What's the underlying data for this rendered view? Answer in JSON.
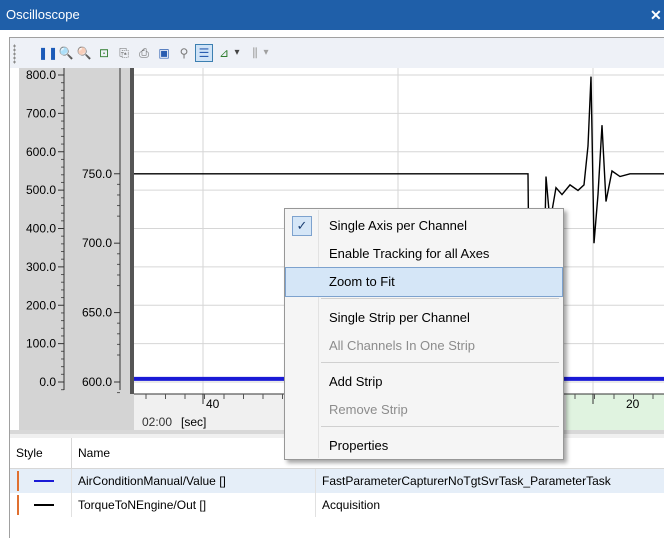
{
  "window": {
    "title": "Oscilloscope",
    "close_glyph": "✕"
  },
  "toolbar": {
    "buttons": [
      {
        "name": "pause-button",
        "icon": "pause-icon",
        "glyph": "❚❚",
        "color": "#1c5bb8"
      },
      {
        "name": "zoom-in-button",
        "icon": "zoom-in-icon",
        "glyph": "🔍",
        "color": "#2f7d2f"
      },
      {
        "name": "zoom-out-button",
        "icon": "zoom-out-icon",
        "glyph": "🔍",
        "color": "#2f7d2f"
      },
      {
        "name": "zoom-fit-button",
        "icon": "zoom-fit-icon",
        "glyph": "⊡",
        "color": "#2f7d2f"
      },
      {
        "name": "copy-button",
        "icon": "copy-icon",
        "glyph": "⎘",
        "color": "#6b6b6b"
      },
      {
        "name": "print-button",
        "icon": "printer-icon",
        "glyph": "⎙",
        "color": "#5d5d5d"
      },
      {
        "name": "save-button",
        "icon": "save-icon",
        "glyph": "▣",
        "color": "#2a5db0"
      },
      {
        "name": "cursor-button",
        "icon": "cursor-icon",
        "glyph": "⚲",
        "color": "#7a7a7a"
      },
      {
        "name": "legend-button",
        "icon": "legend-icon",
        "glyph": "☰",
        "color": "#2a5db0",
        "selected": true
      },
      {
        "name": "axis-options-button",
        "icon": "chart-axis-icon",
        "glyph": "⊿",
        "color": "#2f7d2f"
      },
      {
        "name": "axis-options-dropdown",
        "icon": "chevron-down-icon",
        "glyph": "▾",
        "color": "#444444"
      },
      {
        "name": "measure-button",
        "icon": "measure-icon",
        "glyph": "⫼",
        "color": "#a0a0a0"
      },
      {
        "name": "measure-dropdown",
        "icon": "chevron-down-icon",
        "glyph": "▾",
        "color": "#a0a0a0"
      }
    ]
  },
  "chart_data": {
    "type": "line",
    "xlabel": "[sec]",
    "x_time_label": "02:00",
    "x_tick_labels": [
      "40",
      "20"
    ],
    "y_axis_1": {
      "ticks": [
        "800.0",
        "700.0",
        "600.0",
        "500.0",
        "400.0",
        "300.0",
        "200.0",
        "100.0",
        "0.0"
      ],
      "range": [
        0,
        800
      ]
    },
    "y_axis_2": {
      "ticks": [
        "750.0",
        "700.0",
        "650.0",
        "600.0"
      ],
      "range": [
        600,
        770
      ]
    },
    "series": [
      {
        "name": "AirConditionManual/Value []",
        "color": "#1a1ad6",
        "values": [
          8,
          8
        ]
      },
      {
        "name": "TorqueToNEngine/Out []",
        "color": "#000000",
        "values": [
          750,
          750,
          660,
          762,
          818,
          750
        ]
      }
    ],
    "grid": true
  },
  "context_menu": {
    "items": [
      {
        "label": "Single Axis per Channel",
        "checked": true,
        "disabled": false,
        "highlighted": false
      },
      {
        "label": "Enable Tracking for all Axes",
        "checked": false,
        "disabled": false,
        "highlighted": false
      },
      {
        "label": "Zoom to Fit",
        "checked": false,
        "disabled": false,
        "highlighted": true
      },
      {
        "label": "Single Strip per Channel",
        "checked": false,
        "disabled": false,
        "highlighted": false
      },
      {
        "label": "All Channels In One Strip",
        "checked": false,
        "disabled": true,
        "highlighted": false
      },
      {
        "label": "Add Strip",
        "checked": false,
        "disabled": false,
        "highlighted": false
      },
      {
        "label": "Remove Strip",
        "checked": false,
        "disabled": true,
        "highlighted": false
      },
      {
        "label": "Properties",
        "checked": false,
        "disabled": false,
        "highlighted": false
      }
    ]
  },
  "channels": {
    "headers": {
      "style": "Style",
      "name": "Name"
    },
    "rows": [
      {
        "name": "AirConditionManual/Value []",
        "source": "FastParameterCapturerNoTgtSvrTask_ParameterTask",
        "line_color": "#1a1ad6",
        "marker_color": "#e07030"
      },
      {
        "name": "TorqueToNEngine/Out []",
        "source": "Acquisition",
        "line_color": "#000000",
        "marker_color": "#e07030"
      }
    ]
  },
  "colors": {
    "titlebar": "#1f5fa9",
    "plot_bg": "#ffffff",
    "axis_bg": "#d4d4d4",
    "menu_highlight": "#d5e6f7",
    "strip_highlight": "#e0f3e0",
    "row_selected": "#e5eef8"
  }
}
